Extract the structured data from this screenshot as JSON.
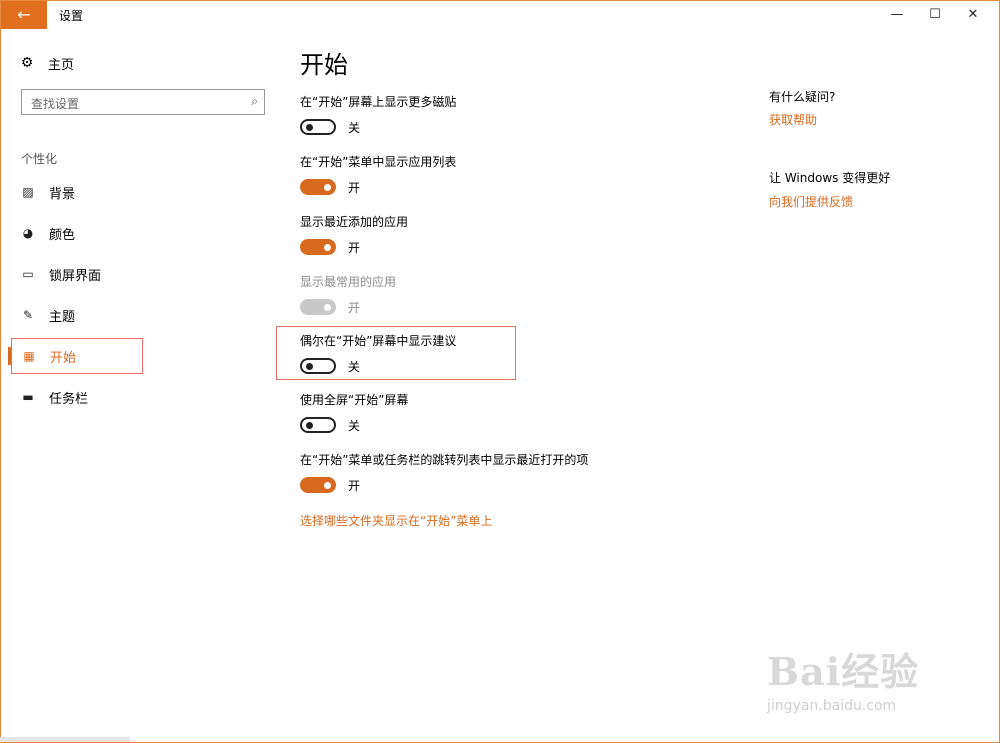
{
  "window": {
    "title": "设置",
    "back_icon": "←",
    "minimize_icon": "—",
    "maximize_icon": "☐",
    "close_icon": "✕"
  },
  "sidebar": {
    "home": {
      "icon": "⚙",
      "label": "主页"
    },
    "search": {
      "placeholder": "查找设置",
      "icon": "⌕"
    },
    "section": "个性化",
    "items": [
      {
        "icon": "▨",
        "label": "背景"
      },
      {
        "icon": "◕",
        "label": "颜色"
      },
      {
        "icon": "▭",
        "label": "锁屏界面"
      },
      {
        "icon": "✎",
        "label": "主题"
      },
      {
        "icon": "▦",
        "label": "开始"
      },
      {
        "icon": "▬",
        "label": "任务栏"
      }
    ],
    "selected_index": 4
  },
  "main": {
    "title": "开始",
    "settings": [
      {
        "label": "在“开始”屏幕上显示更多磁贴",
        "state": "关",
        "on": false,
        "enabled": true
      },
      {
        "label": "在“开始”菜单中显示应用列表",
        "state": "开",
        "on": true,
        "enabled": true
      },
      {
        "label": "显示最近添加的应用",
        "state": "开",
        "on": true,
        "enabled": true
      },
      {
        "label": "显示最常用的应用",
        "state": "开",
        "on": true,
        "enabled": false
      },
      {
        "label": "偶尔在“开始”屏幕中显示建议",
        "state": "关",
        "on": false,
        "enabled": true
      },
      {
        "label": "使用全屏“开始”屏幕",
        "state": "关",
        "on": false,
        "enabled": true
      },
      {
        "label": "在“开始”菜单或任务栏的跳转列表中显示最近打开的项",
        "state": "开",
        "on": true,
        "enabled": true
      }
    ],
    "folders_link": "选择哪些文件夹显示在“开始”菜单上"
  },
  "help": {
    "question": "有什么疑问?",
    "get_help": "获取帮助",
    "improve": "让 Windows 变得更好",
    "feedback": "向我们提供反馈"
  },
  "colors": {
    "accent": "#d76a1e",
    "highlight": "#e8706a"
  },
  "watermark": {
    "logo": "Bai经验",
    "sub": "jingyan.baidu.com"
  }
}
